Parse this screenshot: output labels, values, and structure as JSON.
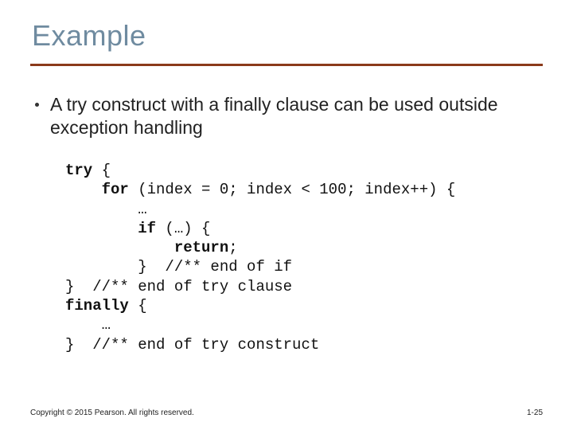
{
  "title": "Example",
  "bullet": "A try construct with a finally clause can be used outside exception handling",
  "code": {
    "l1a": "try",
    "l1b": " {",
    "l2a": "    for",
    "l2b": " (index = 0; index < 100; index++) {",
    "l3": "        …",
    "l4a": "        if",
    "l4b": " (…) {",
    "l5a": "            return",
    "l5b": ";",
    "l6": "        }  //** end of if",
    "l7": "}  //** end of try clause",
    "l8a": "finally",
    "l8b": " {",
    "l9": "    …",
    "l10": "}  //** end of try construct"
  },
  "footer": {
    "copyright": "Copyright © 2015 Pearson. All rights reserved.",
    "page": "1-25"
  }
}
